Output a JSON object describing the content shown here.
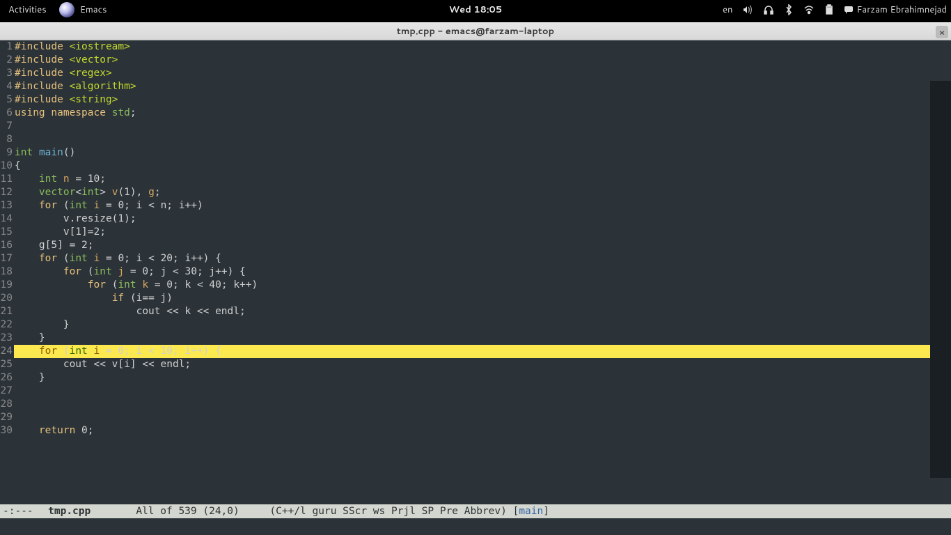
{
  "topbar": {
    "activities": "Activities",
    "app": "Emacs",
    "clock": "Wed 18:05",
    "lang": "en",
    "user": "Farzam Ebrahimnejad"
  },
  "titlebar": {
    "title": "tmp.cpp - emacs@farzam-laptop"
  },
  "code": {
    "lines": [
      {
        "n": 1,
        "segs": [
          [
            "pp",
            "#include"
          ],
          [
            "op",
            " "
          ],
          [
            "str",
            "<iostream>"
          ]
        ]
      },
      {
        "n": 2,
        "segs": [
          [
            "pp",
            "#include"
          ],
          [
            "op",
            " "
          ],
          [
            "str",
            "<vector>"
          ]
        ]
      },
      {
        "n": 3,
        "segs": [
          [
            "pp",
            "#include"
          ],
          [
            "op",
            " "
          ],
          [
            "str",
            "<regex>"
          ]
        ]
      },
      {
        "n": 4,
        "segs": [
          [
            "pp",
            "#include"
          ],
          [
            "op",
            " "
          ],
          [
            "str",
            "<algorithm>"
          ]
        ]
      },
      {
        "n": 5,
        "segs": [
          [
            "pp",
            "#include"
          ],
          [
            "op",
            " "
          ],
          [
            "str",
            "<string>"
          ]
        ]
      },
      {
        "n": 6,
        "segs": [
          [
            "kw",
            "using"
          ],
          [
            "op",
            " "
          ],
          [
            "kw",
            "namespace"
          ],
          [
            "op",
            " "
          ],
          [
            "type",
            "std"
          ],
          [
            "op",
            ";"
          ]
        ]
      },
      {
        "n": 7,
        "segs": []
      },
      {
        "n": 8,
        "segs": []
      },
      {
        "n": 9,
        "segs": [
          [
            "type",
            "int"
          ],
          [
            "op",
            " "
          ],
          [
            "fn",
            "main"
          ],
          [
            "op",
            "()"
          ]
        ]
      },
      {
        "n": 10,
        "segs": [
          [
            "op",
            "{"
          ]
        ]
      },
      {
        "n": 11,
        "segs": [
          [
            "op",
            "    "
          ],
          [
            "type",
            "int"
          ],
          [
            "op",
            " "
          ],
          [
            "var",
            "n"
          ],
          [
            "op",
            " = 10;"
          ]
        ]
      },
      {
        "n": 12,
        "segs": [
          [
            "op",
            "    "
          ],
          [
            "type",
            "vector"
          ],
          [
            "op",
            "<"
          ],
          [
            "type",
            "int"
          ],
          [
            "op",
            "> "
          ],
          [
            "var",
            "v"
          ],
          [
            "op",
            "(1), "
          ],
          [
            "var",
            "g"
          ],
          [
            "op",
            ";"
          ]
        ]
      },
      {
        "n": 13,
        "segs": [
          [
            "op",
            "    "
          ],
          [
            "kw",
            "for"
          ],
          [
            "op",
            " ("
          ],
          [
            "type",
            "int"
          ],
          [
            "op",
            " "
          ],
          [
            "var",
            "i"
          ],
          [
            "op",
            " = 0; i < n; i++)"
          ]
        ]
      },
      {
        "n": 14,
        "segs": [
          [
            "op",
            "        v.resize(1);"
          ]
        ]
      },
      {
        "n": 15,
        "segs": [
          [
            "op",
            "        v[1]=2;"
          ]
        ]
      },
      {
        "n": 16,
        "segs": [
          [
            "op",
            "    g[5] = 2;"
          ]
        ]
      },
      {
        "n": 17,
        "segs": [
          [
            "op",
            "    "
          ],
          [
            "kw",
            "for"
          ],
          [
            "op",
            " ("
          ],
          [
            "type",
            "int"
          ],
          [
            "op",
            " "
          ],
          [
            "var",
            "i"
          ],
          [
            "op",
            " = 0; i < 20; i++) {"
          ]
        ]
      },
      {
        "n": 18,
        "segs": [
          [
            "op",
            "        "
          ],
          [
            "kw",
            "for"
          ],
          [
            "op",
            " ("
          ],
          [
            "type",
            "int"
          ],
          [
            "op",
            " "
          ],
          [
            "var",
            "j"
          ],
          [
            "op",
            " = 0; j < 30; j++) {"
          ]
        ]
      },
      {
        "n": 19,
        "segs": [
          [
            "op",
            "            "
          ],
          [
            "kw",
            "for"
          ],
          [
            "op",
            " ("
          ],
          [
            "type",
            "int"
          ],
          [
            "op",
            " "
          ],
          [
            "var",
            "k"
          ],
          [
            "op",
            " = 0; k < 40; k++)"
          ]
        ]
      },
      {
        "n": 20,
        "segs": [
          [
            "op",
            "                "
          ],
          [
            "kw",
            "if"
          ],
          [
            "op",
            " (i== j)"
          ]
        ]
      },
      {
        "n": 21,
        "segs": [
          [
            "op",
            "                    cout << k << endl;"
          ]
        ]
      },
      {
        "n": 22,
        "segs": [
          [
            "op",
            "        }"
          ]
        ]
      },
      {
        "n": 23,
        "segs": [
          [
            "op",
            "    }"
          ]
        ]
      },
      {
        "n": 24,
        "hl": true,
        "segs": [
          [
            "op",
            "    "
          ],
          [
            "kw",
            "for"
          ],
          [
            "op",
            " ("
          ],
          [
            "type",
            "int"
          ],
          [
            "op",
            " "
          ],
          [
            "var",
            "i"
          ],
          [
            "op",
            " = 0; i < 10; i++) {"
          ]
        ]
      },
      {
        "n": 25,
        "segs": [
          [
            "op",
            "        cout << v[i] << endl;"
          ]
        ]
      },
      {
        "n": 26,
        "segs": [
          [
            "op",
            "    }"
          ]
        ]
      },
      {
        "n": 27,
        "segs": []
      },
      {
        "n": 28,
        "segs": []
      },
      {
        "n": 29,
        "segs": []
      },
      {
        "n": 30,
        "segs": [
          [
            "op",
            "    "
          ],
          [
            "kw",
            "return"
          ],
          [
            "op",
            " 0;"
          ]
        ]
      }
    ]
  },
  "statusbar": {
    "left": "-:---",
    "file": "tmp.cpp",
    "pos": "All of 539  (24,0)",
    "modes_prefix": "(C++/l guru SScr ws Prjl SP Pre Abbrev) [",
    "mode_main": "main",
    "modes_suffix": "]"
  }
}
